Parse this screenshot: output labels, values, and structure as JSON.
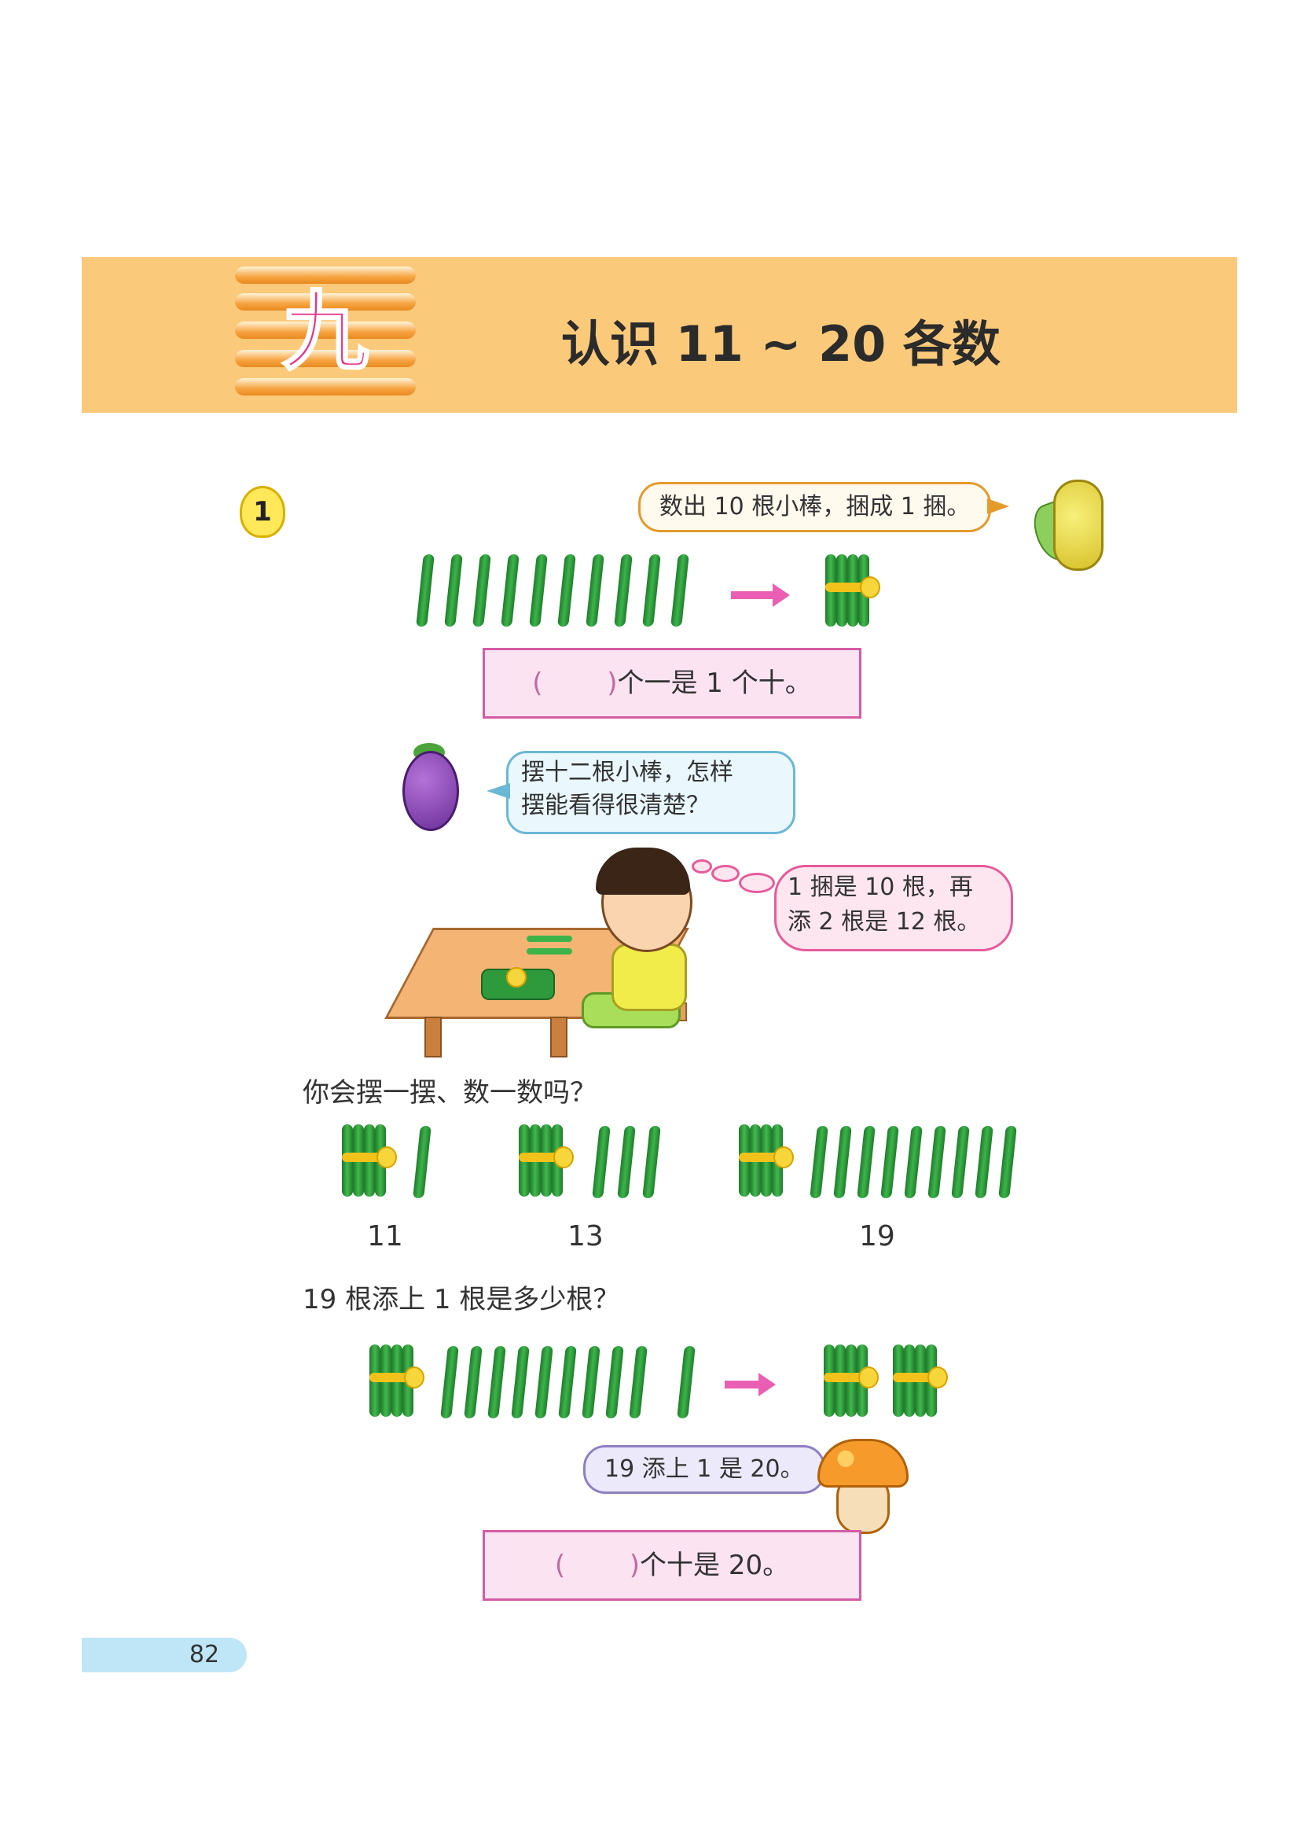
{
  "chapter": {
    "number": "九",
    "title": "认识 11 ~ 20 各数"
  },
  "example": {
    "badge": "1"
  },
  "bubbles": {
    "corn": "数出 10 根小棒，捆成 1 捆。",
    "eggplant_line1": "摆十二根小棒，怎样",
    "eggplant_line2": "摆能看得很清楚？",
    "boy_line1": "1 捆是 10 根，再",
    "boy_line2": "添 2 根是 12 根。",
    "mushroom": "19 添上 1 是 20。"
  },
  "fill_boxes": {
    "box1": {
      "open": "(",
      "close": ")",
      "text": "个一是 1 个十。"
    },
    "box2": {
      "open": "(",
      "close": ")",
      "text": "个十是 20。"
    }
  },
  "questions": {
    "q1": "你会摆一摆、数一数吗？",
    "q2": "19 根添上 1 根是多少根？"
  },
  "number_labels": [
    "11",
    "13",
    "19"
  ],
  "page_number": "82"
}
